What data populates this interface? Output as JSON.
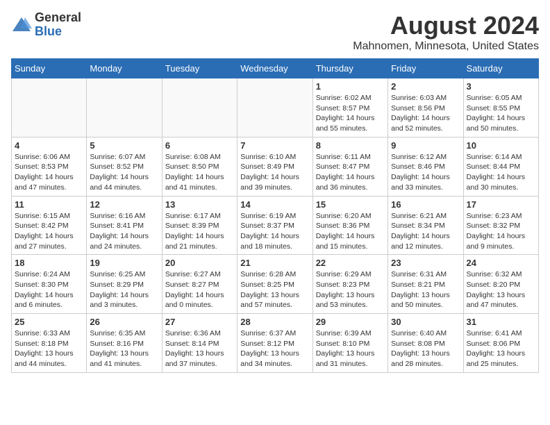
{
  "logo": {
    "general": "General",
    "blue": "Blue"
  },
  "title": "August 2024",
  "location": "Mahnomen, Minnesota, United States",
  "days_of_week": [
    "Sunday",
    "Monday",
    "Tuesday",
    "Wednesday",
    "Thursday",
    "Friday",
    "Saturday"
  ],
  "weeks": [
    [
      {
        "day": "",
        "info": ""
      },
      {
        "day": "",
        "info": ""
      },
      {
        "day": "",
        "info": ""
      },
      {
        "day": "",
        "info": ""
      },
      {
        "day": "1",
        "info": "Sunrise: 6:02 AM\nSunset: 8:57 PM\nDaylight: 14 hours\nand 55 minutes."
      },
      {
        "day": "2",
        "info": "Sunrise: 6:03 AM\nSunset: 8:56 PM\nDaylight: 14 hours\nand 52 minutes."
      },
      {
        "day": "3",
        "info": "Sunrise: 6:05 AM\nSunset: 8:55 PM\nDaylight: 14 hours\nand 50 minutes."
      }
    ],
    [
      {
        "day": "4",
        "info": "Sunrise: 6:06 AM\nSunset: 8:53 PM\nDaylight: 14 hours\nand 47 minutes."
      },
      {
        "day": "5",
        "info": "Sunrise: 6:07 AM\nSunset: 8:52 PM\nDaylight: 14 hours\nand 44 minutes."
      },
      {
        "day": "6",
        "info": "Sunrise: 6:08 AM\nSunset: 8:50 PM\nDaylight: 14 hours\nand 41 minutes."
      },
      {
        "day": "7",
        "info": "Sunrise: 6:10 AM\nSunset: 8:49 PM\nDaylight: 14 hours\nand 39 minutes."
      },
      {
        "day": "8",
        "info": "Sunrise: 6:11 AM\nSunset: 8:47 PM\nDaylight: 14 hours\nand 36 minutes."
      },
      {
        "day": "9",
        "info": "Sunrise: 6:12 AM\nSunset: 8:46 PM\nDaylight: 14 hours\nand 33 minutes."
      },
      {
        "day": "10",
        "info": "Sunrise: 6:14 AM\nSunset: 8:44 PM\nDaylight: 14 hours\nand 30 minutes."
      }
    ],
    [
      {
        "day": "11",
        "info": "Sunrise: 6:15 AM\nSunset: 8:42 PM\nDaylight: 14 hours\nand 27 minutes."
      },
      {
        "day": "12",
        "info": "Sunrise: 6:16 AM\nSunset: 8:41 PM\nDaylight: 14 hours\nand 24 minutes."
      },
      {
        "day": "13",
        "info": "Sunrise: 6:17 AM\nSunset: 8:39 PM\nDaylight: 14 hours\nand 21 minutes."
      },
      {
        "day": "14",
        "info": "Sunrise: 6:19 AM\nSunset: 8:37 PM\nDaylight: 14 hours\nand 18 minutes."
      },
      {
        "day": "15",
        "info": "Sunrise: 6:20 AM\nSunset: 8:36 PM\nDaylight: 14 hours\nand 15 minutes."
      },
      {
        "day": "16",
        "info": "Sunrise: 6:21 AM\nSunset: 8:34 PM\nDaylight: 14 hours\nand 12 minutes."
      },
      {
        "day": "17",
        "info": "Sunrise: 6:23 AM\nSunset: 8:32 PM\nDaylight: 14 hours\nand 9 minutes."
      }
    ],
    [
      {
        "day": "18",
        "info": "Sunrise: 6:24 AM\nSunset: 8:30 PM\nDaylight: 14 hours\nand 6 minutes."
      },
      {
        "day": "19",
        "info": "Sunrise: 6:25 AM\nSunset: 8:29 PM\nDaylight: 14 hours\nand 3 minutes."
      },
      {
        "day": "20",
        "info": "Sunrise: 6:27 AM\nSunset: 8:27 PM\nDaylight: 14 hours\nand 0 minutes."
      },
      {
        "day": "21",
        "info": "Sunrise: 6:28 AM\nSunset: 8:25 PM\nDaylight: 13 hours\nand 57 minutes."
      },
      {
        "day": "22",
        "info": "Sunrise: 6:29 AM\nSunset: 8:23 PM\nDaylight: 13 hours\nand 53 minutes."
      },
      {
        "day": "23",
        "info": "Sunrise: 6:31 AM\nSunset: 8:21 PM\nDaylight: 13 hours\nand 50 minutes."
      },
      {
        "day": "24",
        "info": "Sunrise: 6:32 AM\nSunset: 8:20 PM\nDaylight: 13 hours\nand 47 minutes."
      }
    ],
    [
      {
        "day": "25",
        "info": "Sunrise: 6:33 AM\nSunset: 8:18 PM\nDaylight: 13 hours\nand 44 minutes."
      },
      {
        "day": "26",
        "info": "Sunrise: 6:35 AM\nSunset: 8:16 PM\nDaylight: 13 hours\nand 41 minutes."
      },
      {
        "day": "27",
        "info": "Sunrise: 6:36 AM\nSunset: 8:14 PM\nDaylight: 13 hours\nand 37 minutes."
      },
      {
        "day": "28",
        "info": "Sunrise: 6:37 AM\nSunset: 8:12 PM\nDaylight: 13 hours\nand 34 minutes."
      },
      {
        "day": "29",
        "info": "Sunrise: 6:39 AM\nSunset: 8:10 PM\nDaylight: 13 hours\nand 31 minutes."
      },
      {
        "day": "30",
        "info": "Sunrise: 6:40 AM\nSunset: 8:08 PM\nDaylight: 13 hours\nand 28 minutes."
      },
      {
        "day": "31",
        "info": "Sunrise: 6:41 AM\nSunset: 8:06 PM\nDaylight: 13 hours\nand 25 minutes."
      }
    ]
  ]
}
